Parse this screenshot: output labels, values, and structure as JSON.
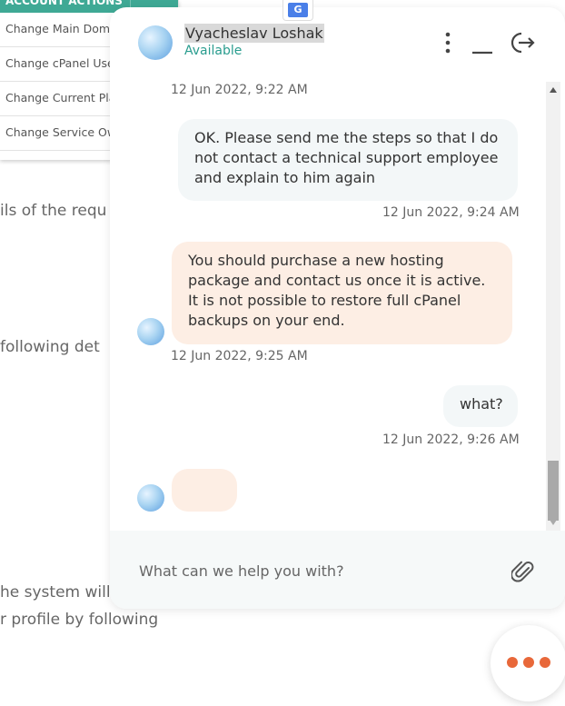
{
  "background": {
    "account_actions": {
      "header": "ACCOUNT ACTIONS",
      "items": [
        "Change Main Doma",
        "Change cPanel Use",
        "Change Current Pla",
        "Change Service Ow"
      ]
    },
    "text_fragments": [
      "ils of the requ",
      "following det",
      "he system will",
      "r profile by following"
    ]
  },
  "translate_badge": "G",
  "chat": {
    "agent": {
      "name": "Vyacheslav Loshak",
      "status": "Available"
    },
    "header_icons": [
      "more-vertical-icon",
      "minimize-icon",
      "exit-icon"
    ],
    "messages": [
      {
        "timestamp": "12 Jun 2022, 9:22 AM"
      },
      {
        "direction": "out",
        "text": "OK. Please send me the steps so that I do not contact a technical support employee and explain to him again",
        "timestamp": "12 Jun 2022, 9:24 AM"
      },
      {
        "direction": "in",
        "text": "You should purchase a new hosting package and contact us once it is active. It is not possible to restore full cPanel backups on your end.",
        "timestamp": "12 Jun 2022, 9:25 AM"
      },
      {
        "direction": "out",
        "text": "what?",
        "timestamp": "12 Jun 2022, 9:26 AM"
      },
      {
        "direction": "in",
        "text": "",
        "typing": true
      }
    ],
    "composer": {
      "placeholder": "What can we help you with?",
      "value": ""
    },
    "colors": {
      "accent": "#2a9d8f",
      "incoming_bubble": "#fdeee4",
      "outgoing_bubble": "#f3f7f8",
      "launcher_dots": "#e8683a"
    }
  }
}
